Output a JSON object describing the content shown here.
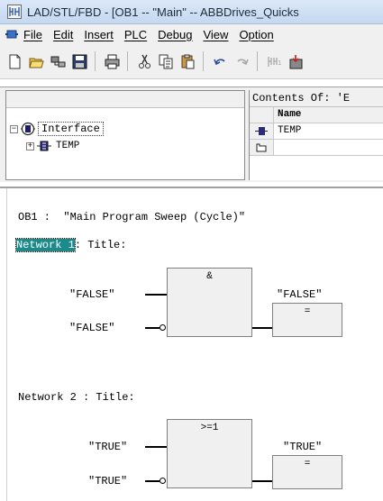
{
  "window": {
    "title": "LAD/STL/FBD  - [OB1 -- \"Main\" -- ABBDrives_Quicks"
  },
  "menu": {
    "items": [
      {
        "label": "File"
      },
      {
        "label": "Edit"
      },
      {
        "label": "Insert"
      },
      {
        "label": "PLC"
      },
      {
        "label": "Debug"
      },
      {
        "label": "View"
      },
      {
        "label": "Option"
      }
    ]
  },
  "toolbar": {
    "icons": [
      "new-icon",
      "open-icon",
      "accessible-nodes-icon",
      "save-icon",
      "print-icon",
      "cut-icon",
      "copy-icon",
      "paste-icon",
      "undo-icon",
      "redo-icon",
      "monitor-icon",
      "download-icon"
    ]
  },
  "interface_panel": {
    "root_label": "Interface",
    "child_label": "TEMP"
  },
  "contents_panel": {
    "header": "Contents Of: 'E",
    "column_name": "Name",
    "rows": [
      {
        "name": "TEMP"
      },
      {
        "name": ""
      }
    ]
  },
  "editor": {
    "block_header": "OB1 :  \"Main Program Sweep (Cycle)\"",
    "networks": [
      {
        "label": "Network 1",
        "title": ": Title:",
        "operator": "&",
        "inputs": [
          "\"FALSE\"",
          "\"FALSE\""
        ],
        "input_negated": [
          false,
          true
        ],
        "output": "\"FALSE\"",
        "assign_symbol": "="
      },
      {
        "label": "Network 2 ",
        "title": ": Title:",
        "operator": ">=1",
        "inputs": [
          "\"TRUE\"",
          "\"TRUE\""
        ],
        "input_negated": [
          false,
          true
        ],
        "output": "\"TRUE\"",
        "assign_symbol": "="
      }
    ]
  }
}
